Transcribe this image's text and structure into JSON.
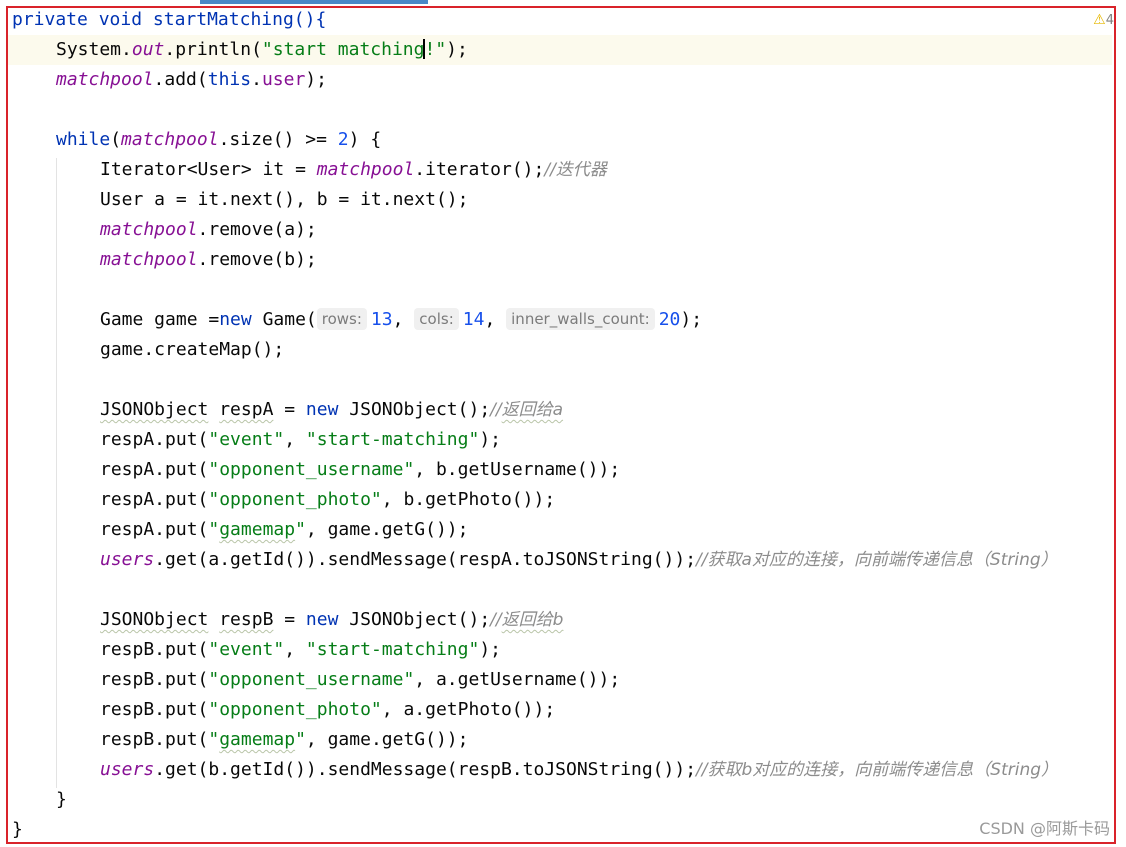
{
  "editor": {
    "warnings_count": "4",
    "lines": {
      "l1": {
        "t1": "private",
        "t2": "void",
        "t3": "startMatching(){"
      },
      "l2": {
        "t1": "System.",
        "t2": "out",
        "t3": ".println(",
        "t4a": "\"start matching",
        "t4b": "!\"",
        "t5": ");"
      },
      "l3": {
        "t1": "matchpool",
        "t2": ".add(",
        "t3": "this",
        "t4": ".",
        "t5": "user",
        "t6": ");"
      },
      "l5": {
        "t1": "while",
        "t2": "(",
        "t3": "matchpool",
        "t4": ".size() >= ",
        "t5": "2",
        "t6": ") {"
      },
      "l6": {
        "t1": "Iterator<User> it = ",
        "t2": "matchpool",
        "t3": ".iterator();",
        "t4": "//迭代器"
      },
      "l7": {
        "t1": "User a = it.next(), b = it.next();"
      },
      "l8": {
        "t1": "matchpool",
        "t2": ".remove(a);"
      },
      "l9": {
        "t1": "matchpool",
        "t2": ".remove(b);"
      },
      "l11": {
        "t1": "Game game =",
        "t2": "new",
        "t3": " Game(",
        "h1": "rows:",
        "n1": "13",
        "c1": ", ",
        "h2": "cols:",
        "n2": "14",
        "c2": ", ",
        "h3": "inner_walls_count:",
        "n3": "20",
        "t4": ");"
      },
      "l12": {
        "t1": "game.createMap();"
      },
      "l14": {
        "t1a": "JSONObject",
        "t1b": " ",
        "t1c": "respA",
        "t1d": " = ",
        "t2": "new",
        "t3": " JSONObject();",
        "t4a": "//",
        "t4b": "返回给a"
      },
      "l15": {
        "t1": "respA.put(",
        "s1": "\"event\"",
        "t2": ", ",
        "s2": "\"start-matching\"",
        "t3": ");"
      },
      "l16": {
        "t1": "respA.put(",
        "s1": "\"opponent_username\"",
        "t2": ", b.getUsername());"
      },
      "l17": {
        "t1": "respA.put(",
        "s1": "\"opponent_photo\"",
        "t2": ", b.getPhoto());"
      },
      "l18": {
        "t1": "respA.put(",
        "s1a": "\"",
        "s1b": "gamemap",
        "s1c": "\"",
        "t2": ", game.getG());"
      },
      "l19": {
        "t1": "users",
        "t2": ".get(a.getId()).sendMessage(respA.toJSONString());",
        "t3": "//获取a对应的连接，向前端传递信息（String）"
      },
      "l21": {
        "t1a": "JSONObject",
        "t1b": " ",
        "t1c": "respB",
        "t1d": " = ",
        "t2": "new",
        "t3": " JSONObject();",
        "t4a": "//",
        "t4b": "返回给b"
      },
      "l22": {
        "t1": "respB.put(",
        "s1": "\"event\"",
        "t2": ", ",
        "s2": "\"start-matching\"",
        "t3": ");"
      },
      "l23": {
        "t1": "respB.put(",
        "s1": "\"opponent_username\"",
        "t2": ", a.getUsername());"
      },
      "l24": {
        "t1": "respB.put(",
        "s1": "\"opponent_photo\"",
        "t2": ", a.getPhoto());"
      },
      "l25": {
        "t1": "respB.put(",
        "s1a": "\"",
        "s1b": "gamemap",
        "s1c": "\"",
        "t2": ", game.getG());"
      },
      "l26": {
        "t1": "users",
        "t2": ".get(b.getId()).sendMessage(respB.toJSONString());",
        "t3": "//获取b对应的连接，向前端传递信息（String）"
      },
      "l27": {
        "t1": "}"
      },
      "l28": {
        "t1": "}"
      }
    }
  },
  "watermark": "CSDN @阿斯卡码",
  "colors": {
    "keyword": "#0033b3",
    "field": "#871094",
    "string": "#067d17",
    "number": "#1750eb",
    "comment": "#8c8c8c",
    "frame": "#d9232a",
    "current_line": "#fcfaed",
    "active_tab": "#4a88c7"
  },
  "icons": {
    "warning": "warning-triangle-icon"
  }
}
